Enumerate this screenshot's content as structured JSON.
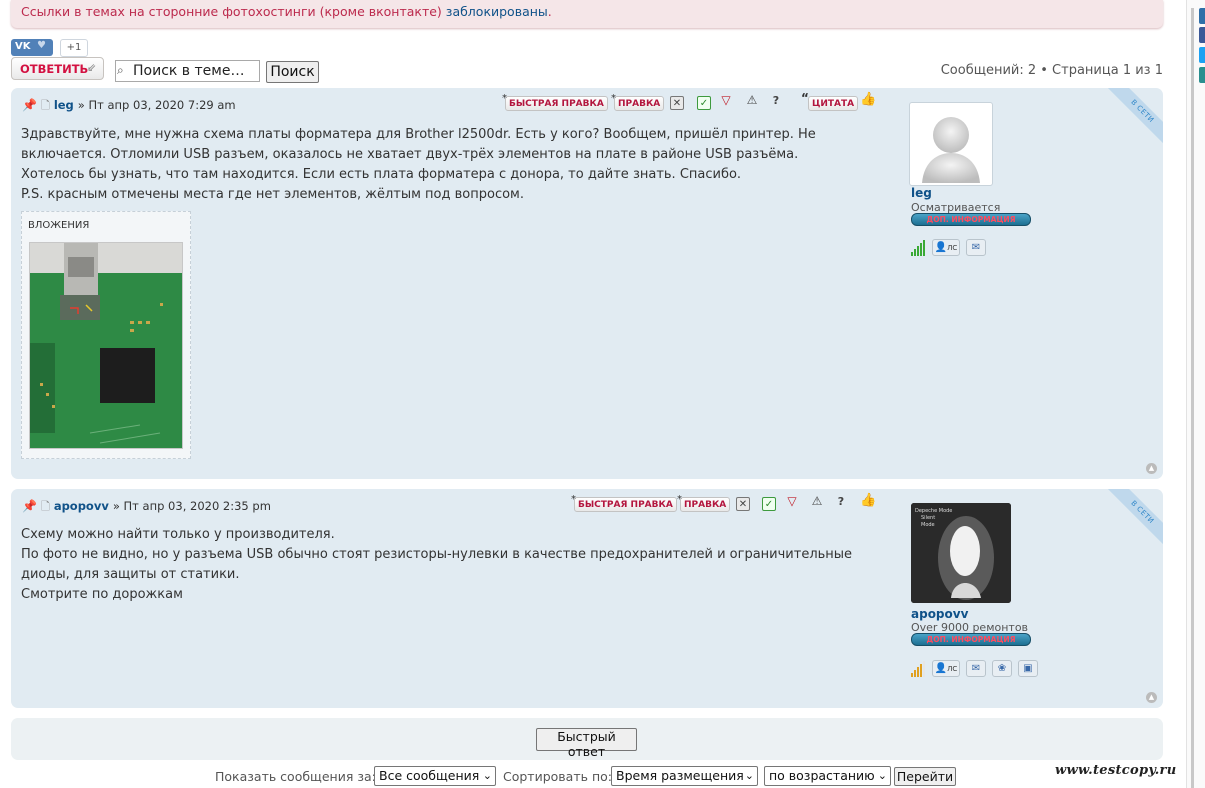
{
  "notice": {
    "text": "Ссылки в темах на сторонние фотохостинги (кроме вконтакте)",
    "link": "заблокированы",
    "period": "."
  },
  "share": {
    "vk_label": "VK",
    "like_symbol": "♥",
    "plus_one": "+1"
  },
  "toolbar": {
    "reply_label": "ОТВЕТИТЬ",
    "search_placeholder": "Поиск в теме…",
    "search_button": "Поиск",
    "pagination": "Сообщений: 2 • Страница 1 из 1"
  },
  "post_buttons": {
    "quick_edit": "БЫСТРАЯ ПРАВКА",
    "edit": "ПРАВКА",
    "quote": "ЦИТАТА"
  },
  "online_badge": "В СЕТИ",
  "posts": [
    {
      "author": "leg",
      "date": "» Пт апр 03, 2020 7:29 am",
      "lines": [
        "Здравствуйте, мне нужна схема платы форматера для Brother l2500dr. Есть у кого? Вообщем, пришёл принтер. Не",
        "включается. Отломили USB разъем, оказалось не хватает двух-трёх элементов на плате в районе USB разъёма.",
        "Хотелось бы узнать, что там находится. Если есть плата форматера с донора, то дайте знать. Спасибо.",
        "P.S. красным отмечены места где нет элементов, жёлтым под вопросом."
      ],
      "attachments_label": "ВЛОЖЕНИЯ",
      "profile": {
        "username": "leg",
        "rank": "Осматривается",
        "infobar": "ДОП. ИНФОРМАЦИЯ",
        "pm_label": "ЛС"
      }
    },
    {
      "author": "apopovv",
      "date": "» Пт апр 03, 2020 2:35 pm",
      "lines": [
        "Схему можно найти только у производителя.",
        "По фото не видно, но у разъема USB обычно стоят резисторы-нулевки в качестве предохранителей и ограничительные",
        "диоды, для защиты от статики.",
        "Смотрите по дорожкам"
      ],
      "profile": {
        "username": "apopovv",
        "rank": "Over 9000 ремонтов",
        "infobar": "ДОП. ИНФОРМАЦИЯ",
        "pm_label": "ЛС",
        "avatar_lines": [
          "Depeche Mode",
          "Silent",
          "Mode"
        ]
      }
    }
  ],
  "quick_reply_button": "Быстрый ответ",
  "bottom": {
    "show_label": "Показать сообщения за:",
    "show_value": "Все сообщения",
    "sort_label": "Сортировать по:",
    "sort_value": "Время размещения",
    "order_value": "по возрастанию",
    "go_button": "Перейти"
  },
  "watermark": "www.testcopy.ru",
  "colors": {
    "post_bg": "#e1ebf2",
    "link": "#105289",
    "button_red": "#d31141",
    "notice_bg": "#f5e6e8",
    "notice_text": "#bc2a4d"
  }
}
